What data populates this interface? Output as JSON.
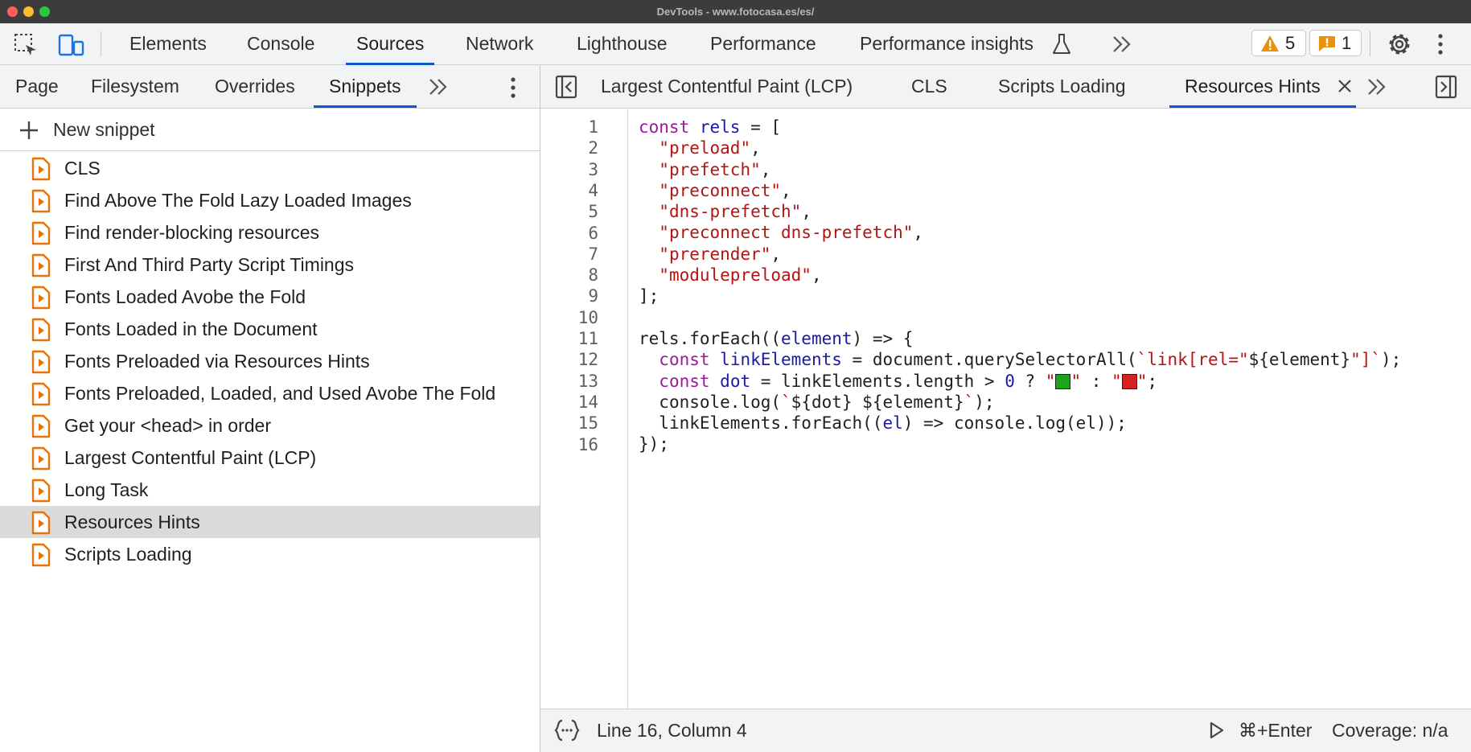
{
  "window": {
    "title": "DevTools - www.fotocasa.es/es/"
  },
  "toolbar": {
    "tabs": [
      "Elements",
      "Console",
      "Sources",
      "Network",
      "Lighthouse",
      "Performance",
      "Performance insights"
    ],
    "active_tab": "Sources",
    "warnings_count": "5",
    "issues_count": "1"
  },
  "navigator": {
    "tabs": [
      "Page",
      "Filesystem",
      "Overrides",
      "Snippets"
    ],
    "active_tab": "Snippets",
    "new_snippet_label": "New snippet",
    "snippets": [
      "CLS",
      "Find Above The Fold Lazy Loaded Images",
      "Find render-blocking resources",
      "First And Third Party Script Timings",
      "Fonts Loaded Avobe the Fold",
      "Fonts Loaded in the Document",
      "Fonts Preloaded via Resources Hints",
      "Fonts Preloaded, Loaded, and Used Avobe The Fold",
      "Get your <head> in order",
      "Largest Contentful Paint (LCP)",
      "Long Task",
      "Resources Hints",
      "Scripts Loading"
    ],
    "selected_snippet": "Resources Hints"
  },
  "editor": {
    "tabs": [
      "Largest Contentful Paint (LCP)",
      "CLS",
      "Scripts Loading",
      "Resources Hints"
    ],
    "active_tab": "Resources Hints",
    "line_numbers": [
      "1",
      "2",
      "3",
      "4",
      "5",
      "6",
      "7",
      "8",
      "9",
      "10",
      "11",
      "12",
      "13",
      "14",
      "15",
      "16"
    ],
    "code": {
      "l1_const": "const",
      "l1_rels": "rels",
      "l1_rest": " = [",
      "l2": "\"preload\"",
      "l3": "\"prefetch\"",
      "l4": "\"preconnect\"",
      "l5": "\"dns-prefetch\"",
      "l6": "\"preconnect dns-prefetch\"",
      "l7": "\"prerender\"",
      "l8": "\"modulepreload\"",
      "l9": "];",
      "l11_a": "rels.forEach((",
      "l11_b": "element",
      "l11_c": ") => {",
      "l12_kw": "const",
      "l12_var": "linkElements",
      "l12_mid": " = document.querySelectorAll(",
      "l12_s1": "`link[rel=\"",
      "l12_tpl": "${element}",
      "l12_s2": "\"]`",
      "l12_end": ");",
      "l13_kw": "const",
      "l13_var": "dot",
      "l13_mid": " = linkElements.length > ",
      "l13_num": "0",
      "l13_q": " ? ",
      "l13_colon": " : ",
      "l14_a": "console.log(",
      "l14_s": "`",
      "l14_tpl": "${dot} ${element}",
      "l14_end": ");",
      "l15_a": "linkElements.forEach((",
      "l15_b": "el",
      "l15_c": ") => console.log(el));",
      "l16": "});"
    },
    "square_colors": {
      "green": "#1aa51a",
      "red": "#d92020"
    }
  },
  "status": {
    "cursor": "Line 16, Column 4",
    "run_shortcut": "⌘+Enter",
    "coverage": "Coverage: n/a"
  }
}
